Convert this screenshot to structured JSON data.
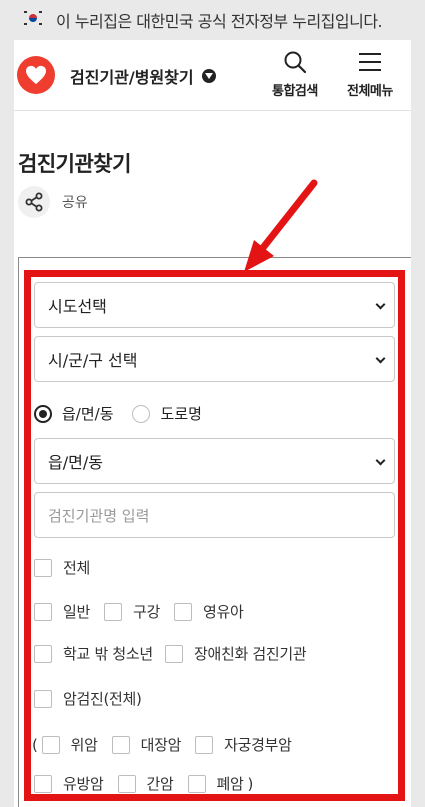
{
  "gov_banner": {
    "text": "이 누리집은 대한민국 공식 전자정부 누리집입니다."
  },
  "header": {
    "site_title": "검진기관/병원찾기",
    "search_label": "통합검색",
    "menu_label": "전체메뉴",
    "brand_color": "#ef3e2f"
  },
  "page": {
    "title": "검진기관찾기",
    "share_label": "공유"
  },
  "form": {
    "sido_select": "시도선택",
    "sigungu_select": "시/군/구 선택",
    "address_type": {
      "options": [
        "읍/면/동",
        "도로명"
      ],
      "selected": "읍/면/동"
    },
    "emd_select": "읍/면/동",
    "name_input_placeholder": "검진기관명 입력",
    "checkbox_all": "전체",
    "checkbox_row1": [
      "일반",
      "구강",
      "영유아"
    ],
    "checkbox_row2": [
      "학교 밖 청소년",
      "장애친화 검진기관"
    ],
    "checkbox_cancer_all": "암검진(전체)",
    "paren_open": "(",
    "paren_close": ")",
    "cancer_row1": [
      "위암",
      "대장암",
      "자궁경부암"
    ],
    "cancer_row2": [
      "유방암",
      "간암",
      "폐암"
    ]
  },
  "annotation": {
    "highlight_color": "#e41414"
  }
}
